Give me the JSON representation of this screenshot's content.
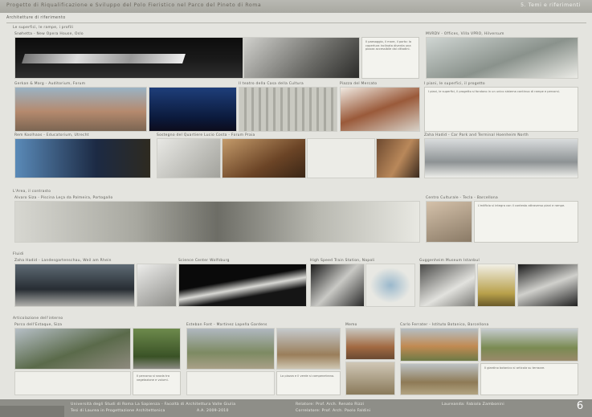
{
  "header": {
    "title": "Progetto di Riqualificazione e Sviluppo del Polo Fieristico nel Parco del Pineto di Roma",
    "section": "5. Temi e riferimenti"
  },
  "sections": {
    "main": "Architetture di riferimento",
    "s1": "Le superfici, le rampe, i profili",
    "s2": "L'Area, il contrasto",
    "s3": "Fluidi",
    "s4": "Articolazione dell'interno"
  },
  "labels": {
    "snohetta": "Snøhetta - New Opera House, Oslo",
    "mvrdv": "MVRDV - Offices, Villa VPRO, Hilversum",
    "gerkan": "Gerkan & Marg - Auditorium, Forum",
    "casa_cultura": "Il teatro della Casa della Cultura",
    "piazza": "Piazza del Mercato",
    "piani": "I piani, le superfici, il progetto",
    "rem": "Rem Koolhaas - Educatorium, Utrecht",
    "lucio": "Sostegno del Quartiere Lucio Costa - Forum Praia",
    "zaha1": "Zaha Hadid - Car Park and Terminal Hoenheim North",
    "alvaro": "Alvaro Siza - Piscina Leça da Palmeira, Portogallo",
    "moret": "Centro Culturale - Tecla - Barcellona",
    "zaha2": "Zaha Hadid - Landesgartenschau, Weil am Rhein",
    "science": "Science Center Wolfsburg",
    "train": "High Speed Train Station, Napoli",
    "museum": "Guggenheim Museum Istanbul",
    "parco": "Parco dell'Estaque, Siza",
    "gardens": "Esteban Font - Martinez Lapeña Gardens",
    "memo": "Memo",
    "carlo": "Carlo Ferrater - Istituto Botanico, Barcellona"
  },
  "texts": {
    "snohetta": "Il paesaggio, il mare, il porto: la copertura inclinata diventa una piazza accessibile dai cittadini.",
    "piani": "I piani, le superfici, il progetto si fondono in un unico sistema continuo di rampe e percorsi.",
    "moret": "L'edificio si integra con il contesto attraverso piani e rampe.",
    "parco": "Il percorso si snoda tra vegetazione e volumi.",
    "gardens": "La piazza e il verde si compenetrano.",
    "carlo": "Il giardino botanico si articola su terrazze."
  },
  "footer": {
    "university": "Università degli Studi di Roma La Sapienza - Facoltà di Architettura Valle Giulia",
    "thesis": "Tesi di Laurea in Progettazione Architettonica",
    "year": "A.A. 2009-2010",
    "relatore": "Relatore: Prof. Arch. Renato Rizzi",
    "correlatore": "Correlatore: Prof. Arch. Paolo Faldini",
    "laureanda": "Laureanda: Fabiola Zambonini",
    "page": "6"
  }
}
